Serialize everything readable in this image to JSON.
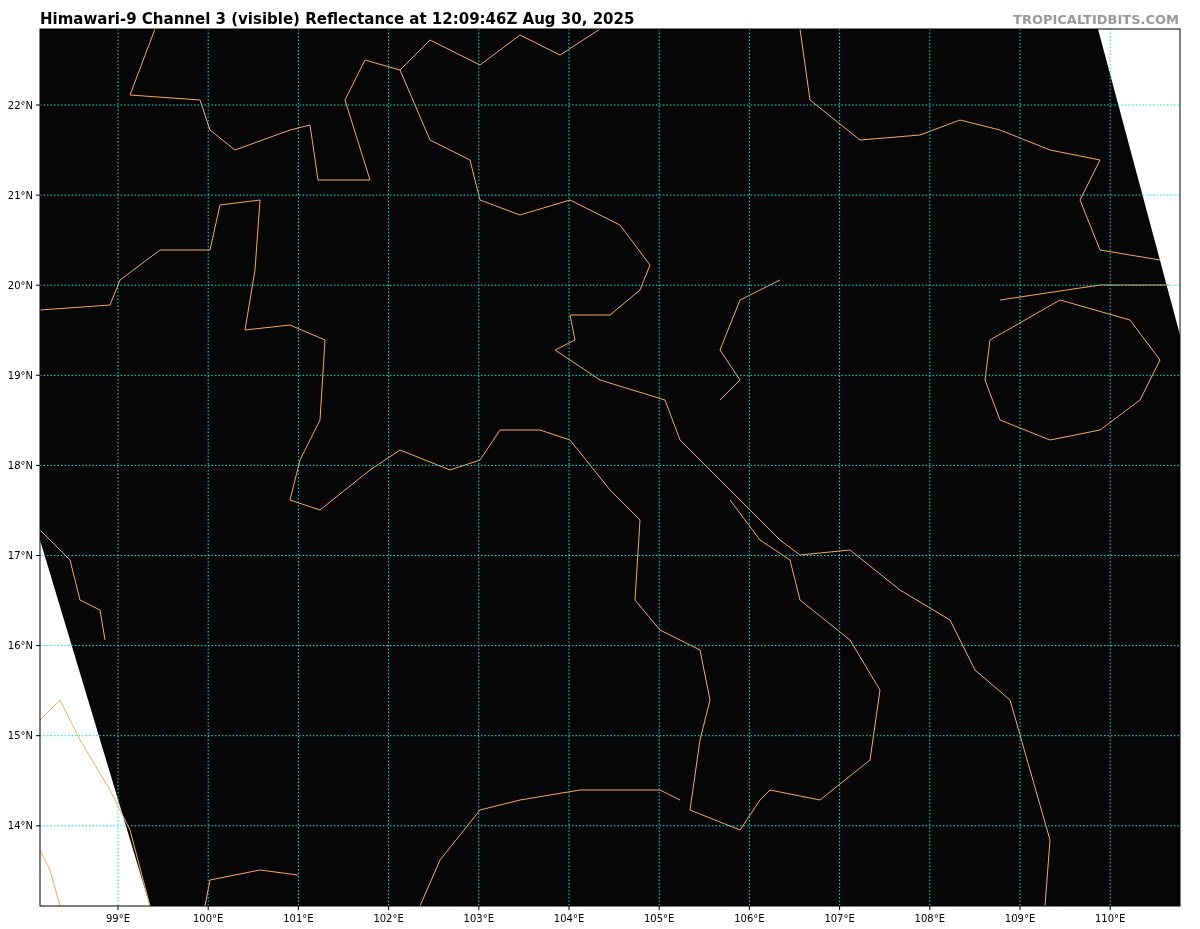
{
  "title": "Himawari-9 Channel 3 (visible) Reflectance at 12:09:46Z Aug 30, 2025",
  "credit": "TROPICALTIDBITS.COM",
  "map": {
    "lat_labels": [
      "22°N",
      "21°N",
      "20°N",
      "19°N",
      "18°N",
      "17°N",
      "16°N",
      "15°N",
      "14°N"
    ],
    "lon_labels": [
      "99°E",
      "100°E",
      "101°E",
      "102°E",
      "103°E",
      "104°E",
      "105°E",
      "106°E",
      "107°E",
      "108°E",
      "109°E",
      "110°E"
    ]
  }
}
